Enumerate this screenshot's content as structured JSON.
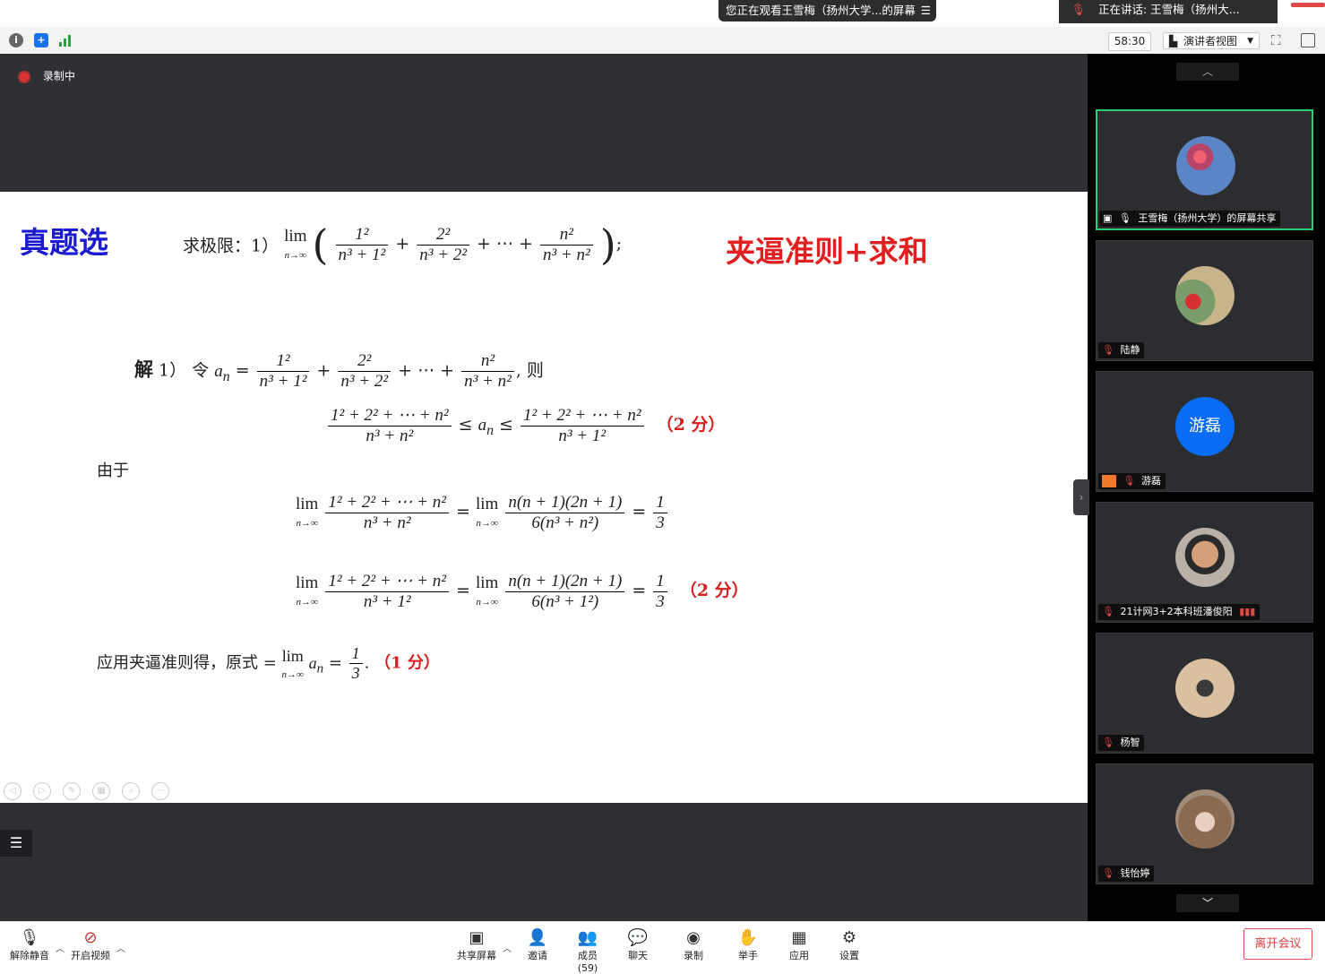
{
  "top": {
    "viewing_banner": "您正在观看王雪梅（扬州大学...的屏幕",
    "speaking_banner": "正在讲话: 王雪梅（扬州大...",
    "timer": "58:30",
    "view_mode": "演讲者视图"
  },
  "recording": {
    "label": "录制中"
  },
  "slide": {
    "section_title": "真题选",
    "problem_label": "求极限：1）",
    "tag": "夹逼准则+求和",
    "sol_label": "解",
    "sol_index": "1）",
    "sol_let": "令",
    "sol_then": "则",
    "since_label": "由于",
    "conclusion_text": "应用夹逼准则得，原式",
    "score_2a": "（2 分）",
    "score_2b": "（2 分）",
    "score_1": "（1 分）"
  },
  "participants": [
    {
      "name": "王雪梅（扬州大学）的屏幕共享",
      "active": true,
      "avatar": "plum-blossom"
    },
    {
      "name": "陆静",
      "avatar": "food-photo"
    },
    {
      "name": "游磊",
      "avatar_text": "游磊",
      "avatar_color": "#0a6cf5"
    },
    {
      "name": "21计网3+2本科班潘俊阳",
      "avatar": "person-photo"
    },
    {
      "name": "杨智",
      "avatar": "bike-photo"
    },
    {
      "name": "钱怡婷",
      "avatar": "hat-photo"
    }
  ],
  "bottom": {
    "unmute": "解除静音",
    "start_video": "开启视频",
    "share_screen": "共享屏幕",
    "invite": "邀请",
    "members": "成员(59)",
    "chat": "聊天",
    "record": "录制",
    "raise_hand": "举手",
    "apps": "应用",
    "settings": "设置",
    "leave": "离开会议"
  }
}
